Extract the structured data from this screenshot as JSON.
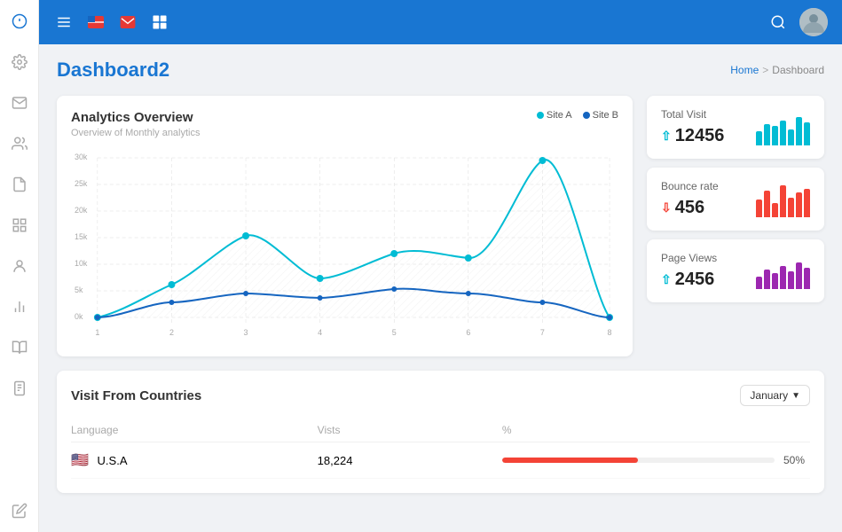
{
  "window": {
    "title": "Dashboard"
  },
  "sidebar": {
    "icons": [
      {
        "name": "notification-icon",
        "label": "Notifications"
      },
      {
        "name": "settings-icon",
        "label": "Settings"
      },
      {
        "name": "mail-icon",
        "label": "Mail"
      },
      {
        "name": "users-icon",
        "label": "Users"
      },
      {
        "name": "file-icon",
        "label": "Files"
      },
      {
        "name": "grid-icon",
        "label": "Grid"
      },
      {
        "name": "team-icon",
        "label": "Team"
      },
      {
        "name": "chart-icon",
        "label": "Chart"
      },
      {
        "name": "book-icon",
        "label": "Book"
      },
      {
        "name": "report-icon",
        "label": "Report"
      },
      {
        "name": "edit-icon",
        "label": "Edit"
      }
    ]
  },
  "topbar": {
    "menu_icon": "☰",
    "search_icon": "search",
    "icons": [
      "menu",
      "flag-red",
      "mail-red",
      "grid"
    ]
  },
  "header": {
    "title": "Dashboard2",
    "breadcrumb_home": "Home",
    "breadcrumb_sep": ">",
    "breadcrumb_current": "Dashboard"
  },
  "analytics": {
    "title": "Analytics Overview",
    "subtitle": "Overview of Monthly analytics",
    "legend": [
      {
        "label": "Site A",
        "color": "#00bcd4"
      },
      {
        "label": "Site B",
        "color": "#1565c0"
      }
    ],
    "y_labels": [
      "30k",
      "25k",
      "20k",
      "15k",
      "10k",
      "5k",
      "0k"
    ],
    "x_labels": [
      "1",
      "2",
      "3",
      "4",
      "5",
      "6",
      "7",
      "8"
    ]
  },
  "stats": [
    {
      "label": "Total Visit",
      "value": "12456",
      "trend": "up",
      "bar_color": "#00bcd4",
      "bars": [
        40,
        60,
        55,
        70,
        45,
        80,
        65
      ]
    },
    {
      "label": "Bounce rate",
      "value": "456",
      "trend": "down",
      "bar_color": "#f44336",
      "bars": [
        50,
        75,
        40,
        90,
        55,
        70,
        80
      ]
    },
    {
      "label": "Page Views",
      "value": "2456",
      "trend": "up",
      "bar_color": "#9c27b0",
      "bars": [
        35,
        55,
        45,
        65,
        50,
        75,
        60
      ]
    }
  ],
  "countries": {
    "title": "Visit From Countries",
    "month_selector": "January",
    "columns": {
      "language": "Language",
      "visits": "Vists",
      "percent": "%"
    },
    "rows": [
      {
        "flag": "🇺🇸",
        "country": "U.S.A",
        "visits": "18,224",
        "percent": 50,
        "bar_color": "#f44336"
      }
    ]
  }
}
